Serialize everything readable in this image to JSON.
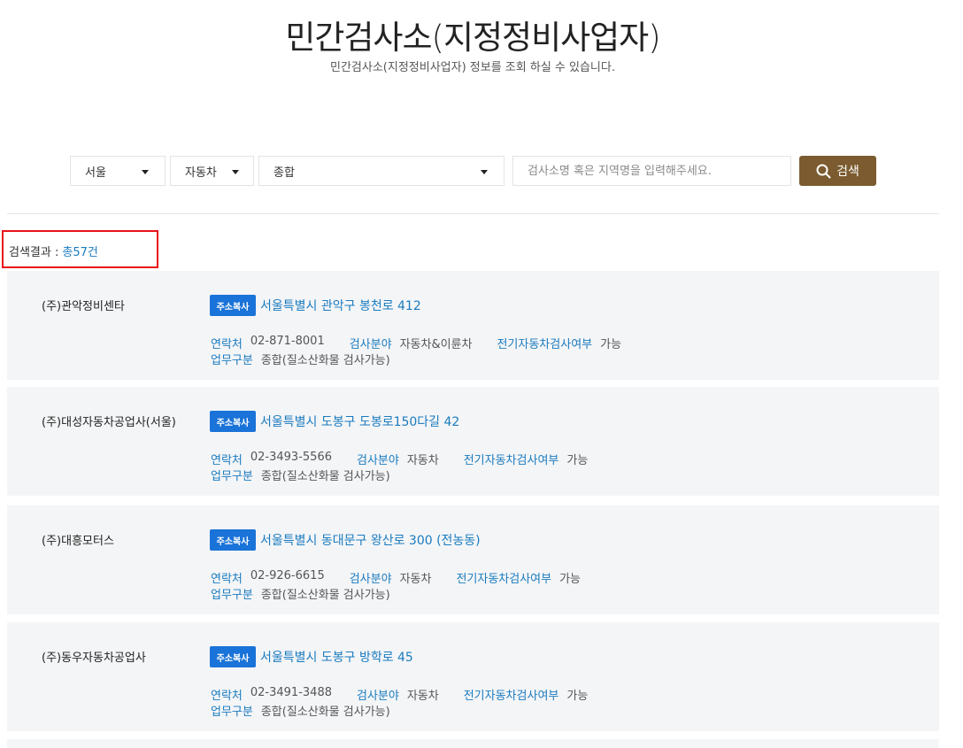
{
  "header": {
    "title": "민간검사소(지정정비사업자)",
    "subtitle": "민간검사소(지정정비사업자) 정보를 조회 하실 수 있습니다."
  },
  "filters": {
    "region": "서울",
    "vehicle_type": "자동차",
    "category": "종합",
    "search_placeholder": "검사소명 혹은 지역명을 입력해주세요.",
    "search_value": "",
    "search_button": "검색"
  },
  "results": {
    "label": "검색결과 :",
    "count": "총57건"
  },
  "labels": {
    "copy_badge": "주소복사",
    "contact": "연락처",
    "field": "검사분야",
    "ev": "전기자동차검사여부",
    "division": "업무구분"
  },
  "stations": [
    {
      "name": "(주)관악정비센타",
      "address": "서울특별시 관악구 봉천로 412",
      "phone": "02-871-8001",
      "field": "자동차&이륜차",
      "ev": "가능",
      "division": "종합(질소산화물 검사가능)"
    },
    {
      "name": "(주)대성자동차공업사(서울)",
      "address": "서울특별시 도봉구 도봉로150다길 42",
      "phone": "02-3493-5566",
      "field": "자동차",
      "ev": "가능",
      "division": "종합(질소산화물 검사가능)"
    },
    {
      "name": "(주)대흥모터스",
      "address": "서울특별시 동대문구 왕산로 300 (전농동)",
      "phone": "02-926-6615",
      "field": "자동차",
      "ev": "가능",
      "division": "종합(질소산화물 검사가능)"
    },
    {
      "name": "(주)동우자동차공업사",
      "address": "서울특별시 도봉구 방학로 45",
      "phone": "02-3491-3488",
      "field": "자동차",
      "ev": "가능",
      "division": "종합(질소산화물 검사가능)"
    }
  ],
  "colors": {
    "accent_blue": "#1a7bbf",
    "badge_blue": "#1a73d8",
    "search_button": "#7b5b2f",
    "highlight_border": "#e8121a",
    "card_bg": "#f4f5f7"
  }
}
